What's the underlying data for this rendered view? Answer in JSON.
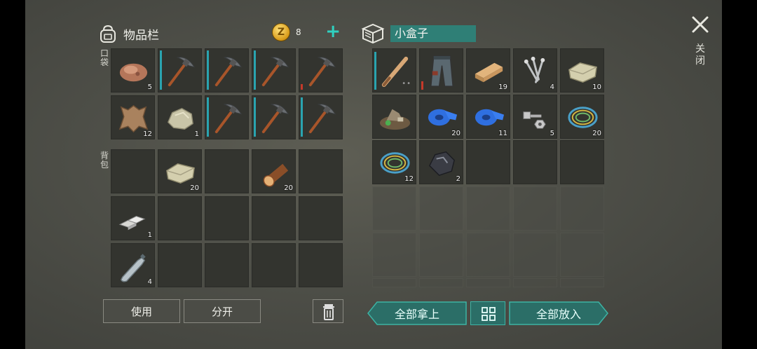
{
  "inventory": {
    "title": "物品栏",
    "coins": "8",
    "pocket_label": "口袋",
    "backpack_label": "背包",
    "pocket": [
      {
        "icon": "stone-icon",
        "qty": "5"
      },
      {
        "icon": "pickaxe-icon",
        "qty": ""
      },
      {
        "icon": "pickaxe-icon",
        "qty": ""
      },
      {
        "icon": "pickaxe-icon",
        "qty": ""
      },
      {
        "icon": "pickaxe-icon",
        "qty": ""
      },
      {
        "icon": "leather-icon",
        "qty": "12"
      },
      {
        "icon": "rock-icon",
        "qty": "1"
      },
      {
        "icon": "pickaxe-icon",
        "qty": ""
      },
      {
        "icon": "pickaxe-icon",
        "qty": ""
      },
      {
        "icon": "pickaxe-icon",
        "qty": ""
      }
    ],
    "backpack": [
      {
        "icon": "",
        "qty": ""
      },
      {
        "icon": "limestone-icon",
        "qty": "20"
      },
      {
        "icon": "",
        "qty": ""
      },
      {
        "icon": "log-icon",
        "qty": "20"
      },
      {
        "icon": "",
        "qty": ""
      },
      {
        "icon": "iron-bar-icon",
        "qty": "1"
      },
      {
        "icon": "",
        "qty": ""
      },
      {
        "icon": "",
        "qty": ""
      },
      {
        "icon": "",
        "qty": ""
      },
      {
        "icon": "",
        "qty": ""
      },
      {
        "icon": "bottle-icon",
        "qty": "4"
      },
      {
        "icon": "",
        "qty": ""
      },
      {
        "icon": "",
        "qty": ""
      },
      {
        "icon": "",
        "qty": ""
      },
      {
        "icon": "",
        "qty": ""
      }
    ],
    "use_label": "使用",
    "split_label": "分开"
  },
  "box": {
    "name": "小盒子",
    "items": [
      {
        "icon": "bat-icon",
        "qty": ""
      },
      {
        "icon": "pants-icon",
        "qty": ""
      },
      {
        "icon": "plank-icon",
        "qty": "19"
      },
      {
        "icon": "nails-icon",
        "qty": "4"
      },
      {
        "icon": "limestone-icon",
        "qty": "10"
      },
      {
        "icon": "scrap-pile-icon",
        "qty": ""
      },
      {
        "icon": "tape-icon",
        "qty": "20"
      },
      {
        "icon": "tape-icon",
        "qty": "11"
      },
      {
        "icon": "bolt-nut-icon",
        "qty": "5"
      },
      {
        "icon": "wire-icon",
        "qty": "20"
      },
      {
        "icon": "wire-icon",
        "qty": "12"
      },
      {
        "icon": "ore-icon",
        "qty": "2"
      }
    ],
    "take_all_label": "全部拿上",
    "put_all_label": "全部放入"
  },
  "close_label": "关闭",
  "colors": {
    "accent": "#2fd1c0",
    "teal_button": "#2b6e67",
    "durability": "#2aa4b0",
    "durability_low": "#c53a2a"
  }
}
